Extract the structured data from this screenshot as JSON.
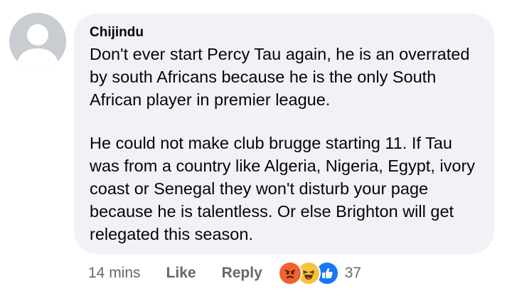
{
  "comment": {
    "author": "Chijindu",
    "paragraphs": [
      "Don't ever start Percy Tau again, he is an overrated by south Africans because he is the only South African player in premier league.",
      "He could not make club brugge starting 11. If Tau was from a country like Algeria, Nigeria, Egypt, ivory coast or Senegal they won't disturb your page because he is talentless. Or else Brighton will get relegated this season."
    ]
  },
  "actions": {
    "time": "14 mins",
    "like_label": "Like",
    "reply_label": "Reply",
    "reaction_icons": [
      "angry-icon",
      "haha-icon",
      "like-icon"
    ],
    "reaction_count": "37"
  },
  "colors": {
    "bubble": "#f0f2f5",
    "avatar": "#c9ccd1",
    "meta_text": "#65676b",
    "angry": "#f0622e",
    "haha": "#f7c33a",
    "like": "#1877f2"
  }
}
